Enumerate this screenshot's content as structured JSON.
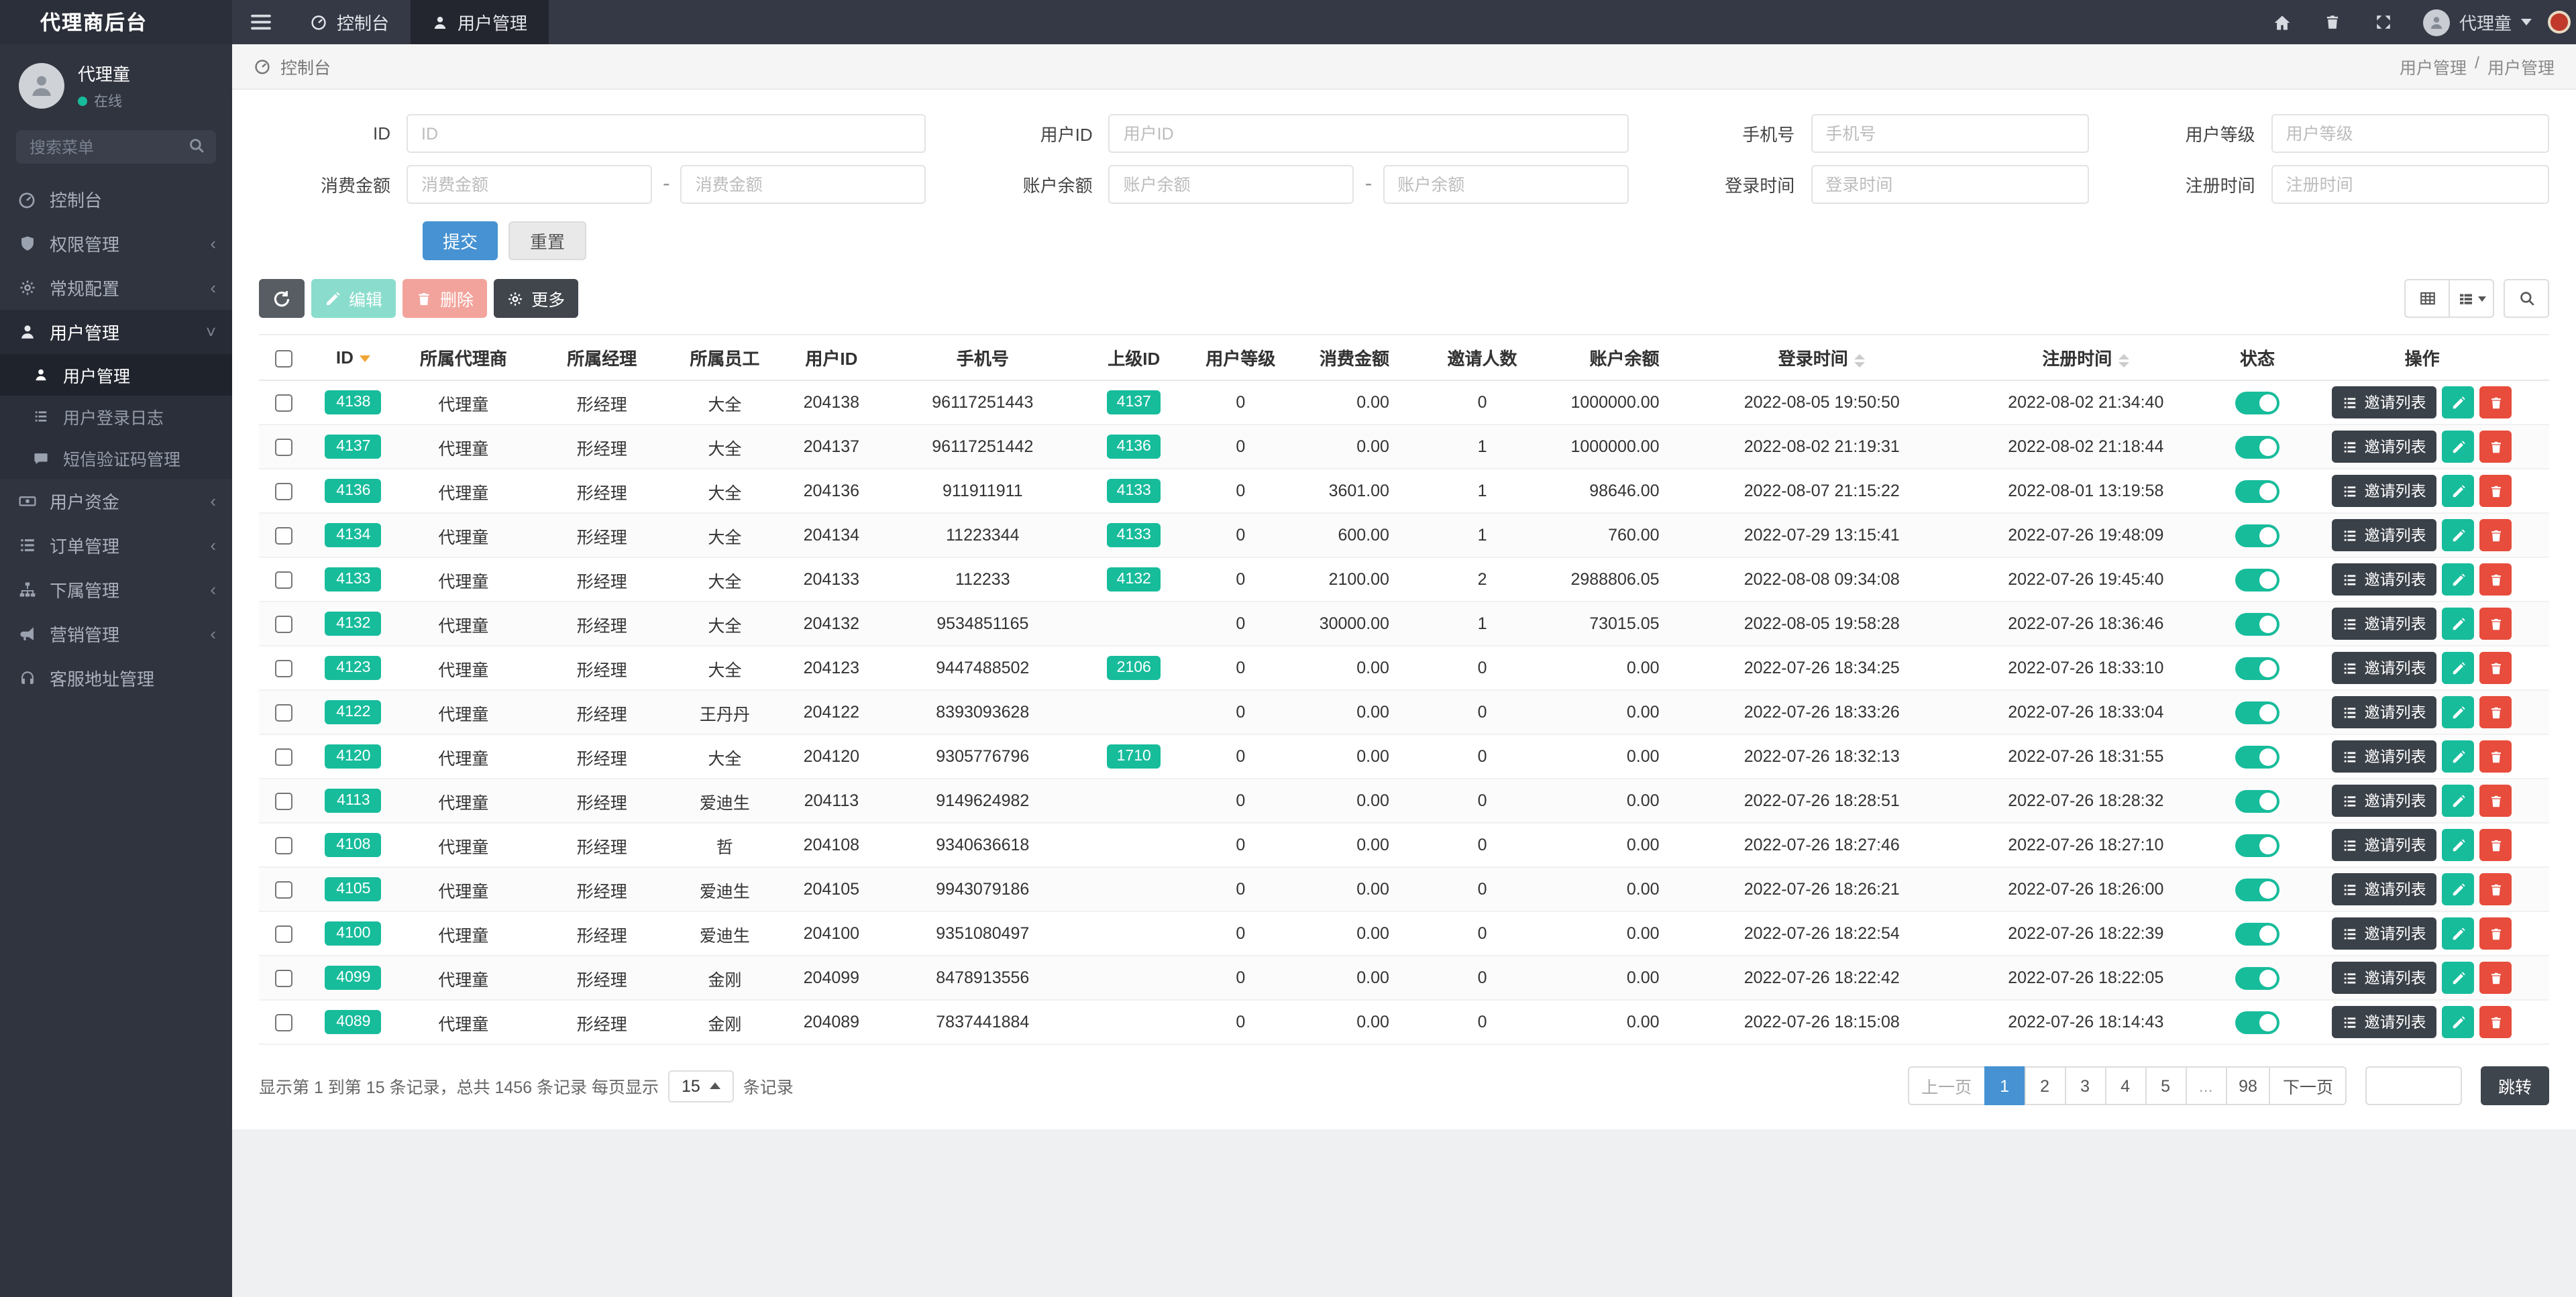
{
  "colors": {
    "accent_teal": "#17bc9b",
    "primary_blue": "#4692d3",
    "danger_red": "#e74c3c",
    "dark": "#30343f"
  },
  "app": {
    "brand": "代理商后台"
  },
  "topbar": {
    "nav": [
      {
        "label": "控制台"
      },
      {
        "label": "用户管理"
      }
    ],
    "user_name": "代理童"
  },
  "sidebar": {
    "profile": {
      "name": "代理童",
      "status": "在线"
    },
    "search_placeholder": "搜索菜单",
    "menu": [
      {
        "label": "控制台"
      },
      {
        "label": "权限管理"
      },
      {
        "label": "常规配置"
      },
      {
        "label": "用户管理"
      },
      {
        "label": "用户资金"
      },
      {
        "label": "订单管理"
      },
      {
        "label": "下属管理"
      },
      {
        "label": "营销管理"
      },
      {
        "label": "客服地址管理"
      }
    ],
    "submenu": [
      {
        "label": "用户管理"
      },
      {
        "label": "用户登录日志"
      },
      {
        "label": "短信验证码管理"
      }
    ]
  },
  "breadcrumb": {
    "home": "控制台",
    "section": "用户管理",
    "page": "用户管理"
  },
  "filters": {
    "fields": {
      "id": {
        "label": "ID",
        "placeholder": "ID"
      },
      "user_id": {
        "label": "用户ID",
        "placeholder": "用户ID"
      },
      "phone": {
        "label": "手机号",
        "placeholder": "手机号"
      },
      "level": {
        "label": "用户等级",
        "placeholder": "用户等级"
      },
      "consume": {
        "label": "消费金额",
        "placeholder": "消费金额"
      },
      "balance": {
        "label": "账户余额",
        "placeholder": "账户余额"
      },
      "login_time": {
        "label": "登录时间",
        "placeholder": "登录时间"
      },
      "reg_time": {
        "label": "注册时间",
        "placeholder": "注册时间"
      }
    },
    "range_separator": "-",
    "submit": "提交",
    "reset": "重置"
  },
  "toolbar": {
    "edit": "编辑",
    "delete": "删除",
    "more": "更多"
  },
  "table": {
    "columns": [
      "ID",
      "所属代理商",
      "所属经理",
      "所属员工",
      "用户ID",
      "手机号",
      "上级ID",
      "用户等级",
      "消费金额",
      "邀请人数",
      "账户余额",
      "登录时间",
      "注册时间",
      "状态",
      "操作"
    ],
    "invite_label": "邀请列表",
    "rows": [
      {
        "id": "4138",
        "agent": "代理童",
        "manager": "形经理",
        "staff": "大全",
        "user_id": "204138",
        "phone": "96117251443",
        "parent_id": "4137",
        "level": "0",
        "consume": "0.00",
        "invites": "0",
        "balance": "1000000.00",
        "login_time": "2022-08-05 19:50:50",
        "reg_time": "2022-08-02 21:34:40"
      },
      {
        "id": "4137",
        "agent": "代理童",
        "manager": "形经理",
        "staff": "大全",
        "user_id": "204137",
        "phone": "96117251442",
        "parent_id": "4136",
        "level": "0",
        "consume": "0.00",
        "invites": "1",
        "balance": "1000000.00",
        "login_time": "2022-08-02 21:19:31",
        "reg_time": "2022-08-02 21:18:44"
      },
      {
        "id": "4136",
        "agent": "代理童",
        "manager": "形经理",
        "staff": "大全",
        "user_id": "204136",
        "phone": "911911911",
        "parent_id": "4133",
        "level": "0",
        "consume": "3601.00",
        "invites": "1",
        "balance": "98646.00",
        "login_time": "2022-08-07 21:15:22",
        "reg_time": "2022-08-01 13:19:58"
      },
      {
        "id": "4134",
        "agent": "代理童",
        "manager": "形经理",
        "staff": "大全",
        "user_id": "204134",
        "phone": "11223344",
        "parent_id": "4133",
        "level": "0",
        "consume": "600.00",
        "invites": "1",
        "balance": "760.00",
        "login_time": "2022-07-29 13:15:41",
        "reg_time": "2022-07-26 19:48:09"
      },
      {
        "id": "4133",
        "agent": "代理童",
        "manager": "形经理",
        "staff": "大全",
        "user_id": "204133",
        "phone": "112233",
        "parent_id": "4132",
        "level": "0",
        "consume": "2100.00",
        "invites": "2",
        "balance": "2988806.05",
        "login_time": "2022-08-08 09:34:08",
        "reg_time": "2022-07-26 19:45:40"
      },
      {
        "id": "4132",
        "agent": "代理童",
        "manager": "形经理",
        "staff": "大全",
        "user_id": "204132",
        "phone": "9534851165",
        "parent_id": "",
        "level": "0",
        "consume": "30000.00",
        "invites": "1",
        "balance": "73015.05",
        "login_time": "2022-08-05 19:58:28",
        "reg_time": "2022-07-26 18:36:46"
      },
      {
        "id": "4123",
        "agent": "代理童",
        "manager": "形经理",
        "staff": "大全",
        "user_id": "204123",
        "phone": "9447488502",
        "parent_id": "2106",
        "level": "0",
        "consume": "0.00",
        "invites": "0",
        "balance": "0.00",
        "login_time": "2022-07-26 18:34:25",
        "reg_time": "2022-07-26 18:33:10"
      },
      {
        "id": "4122",
        "agent": "代理童",
        "manager": "形经理",
        "staff": "王丹丹",
        "user_id": "204122",
        "phone": "8393093628",
        "parent_id": "",
        "level": "0",
        "consume": "0.00",
        "invites": "0",
        "balance": "0.00",
        "login_time": "2022-07-26 18:33:26",
        "reg_time": "2022-07-26 18:33:04"
      },
      {
        "id": "4120",
        "agent": "代理童",
        "manager": "形经理",
        "staff": "大全",
        "user_id": "204120",
        "phone": "9305776796",
        "parent_id": "1710",
        "level": "0",
        "consume": "0.00",
        "invites": "0",
        "balance": "0.00",
        "login_time": "2022-07-26 18:32:13",
        "reg_time": "2022-07-26 18:31:55"
      },
      {
        "id": "4113",
        "agent": "代理童",
        "manager": "形经理",
        "staff": "爱迪生",
        "user_id": "204113",
        "phone": "9149624982",
        "parent_id": "",
        "level": "0",
        "consume": "0.00",
        "invites": "0",
        "balance": "0.00",
        "login_time": "2022-07-26 18:28:51",
        "reg_time": "2022-07-26 18:28:32"
      },
      {
        "id": "4108",
        "agent": "代理童",
        "manager": "形经理",
        "staff": "哲",
        "user_id": "204108",
        "phone": "9340636618",
        "parent_id": "",
        "level": "0",
        "consume": "0.00",
        "invites": "0",
        "balance": "0.00",
        "login_time": "2022-07-26 18:27:46",
        "reg_time": "2022-07-26 18:27:10"
      },
      {
        "id": "4105",
        "agent": "代理童",
        "manager": "形经理",
        "staff": "爱迪生",
        "user_id": "204105",
        "phone": "9943079186",
        "parent_id": "",
        "level": "0",
        "consume": "0.00",
        "invites": "0",
        "balance": "0.00",
        "login_time": "2022-07-26 18:26:21",
        "reg_time": "2022-07-26 18:26:00"
      },
      {
        "id": "4100",
        "agent": "代理童",
        "manager": "形经理",
        "staff": "爱迪生",
        "user_id": "204100",
        "phone": "9351080497",
        "parent_id": "",
        "level": "0",
        "consume": "0.00",
        "invites": "0",
        "balance": "0.00",
        "login_time": "2022-07-26 18:22:54",
        "reg_time": "2022-07-26 18:22:39"
      },
      {
        "id": "4099",
        "agent": "代理童",
        "manager": "形经理",
        "staff": "金刚",
        "user_id": "204099",
        "phone": "8478913556",
        "parent_id": "",
        "level": "0",
        "consume": "0.00",
        "invites": "0",
        "balance": "0.00",
        "login_time": "2022-07-26 18:22:42",
        "reg_time": "2022-07-26 18:22:05"
      },
      {
        "id": "4089",
        "agent": "代理童",
        "manager": "形经理",
        "staff": "金刚",
        "user_id": "204089",
        "phone": "7837441884",
        "parent_id": "",
        "level": "0",
        "consume": "0.00",
        "invites": "0",
        "balance": "0.00",
        "login_time": "2022-07-26 18:15:08",
        "reg_time": "2022-07-26 18:14:43"
      }
    ]
  },
  "footer": {
    "summary_prefix": "显示第 1 到第 15 条记录，总共 1456 条记录 每页显示",
    "page_size": "15",
    "summary_suffix": "条记录",
    "prev": "上一页",
    "next": "下一页",
    "pages": [
      "1",
      "2",
      "3",
      "4",
      "5",
      "...",
      "98"
    ],
    "active_page": "1",
    "jump_label": "跳转"
  }
}
